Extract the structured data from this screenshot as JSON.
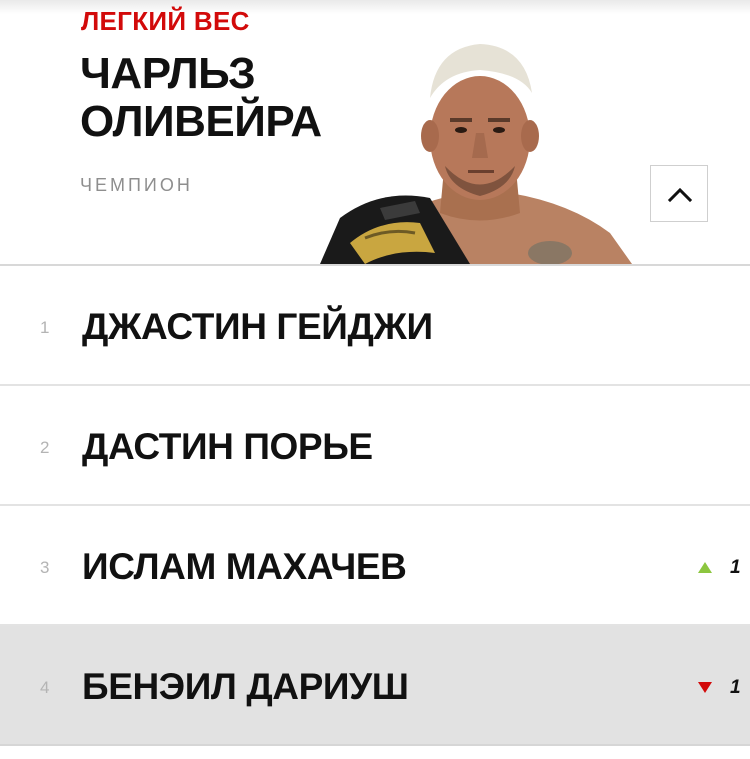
{
  "header": {
    "division": "ЛЕГКИЙ ВЕС",
    "champion_name_line1": "ЧАРЛЬЗ",
    "champion_name_line2": "ОЛИВЕЙРА",
    "champion_label": "ЧЕМПИОН"
  },
  "colors": {
    "accent_red": "#d20a0a",
    "up_green": "#8cc63f",
    "down_red": "#d20a0a",
    "highlight_row": "#e2e2e2"
  },
  "rankings": [
    {
      "rank": "1",
      "name": "ДЖАСТИН ГЕЙДЖИ",
      "movement": "",
      "direction": "none"
    },
    {
      "rank": "2",
      "name": "ДАСТИН ПОРЬЕ",
      "movement": "",
      "direction": "none"
    },
    {
      "rank": "3",
      "name": "ИСЛАМ МАХАЧЕВ",
      "movement": "1",
      "direction": "up"
    },
    {
      "rank": "4",
      "name": "БЕНЭИЛ ДАРИУШ",
      "movement": "1",
      "direction": "down"
    }
  ],
  "icons": {
    "toggle": "chevron-up-icon",
    "up": "triangle-up-icon",
    "down": "triangle-down-icon"
  }
}
